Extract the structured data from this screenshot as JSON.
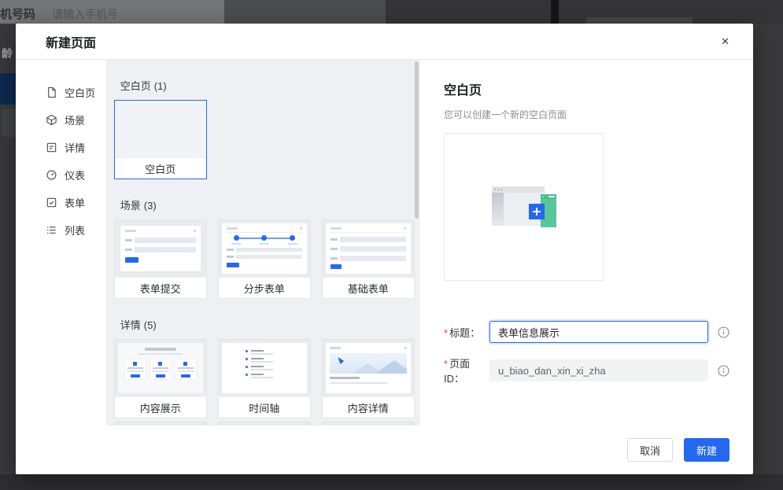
{
  "colors": {
    "primary": "#2468f2",
    "selected_card_border": "#2468f2",
    "required_mark": "#f04134",
    "gallery_bg": "#eef0f3",
    "overlay_bg": "#39393b",
    "illustration_green": "#57c69b",
    "illustration_blue": "#2667f2"
  },
  "backdrop": {
    "phone_label": "机号码",
    "phone_placeholder": "请输入手机号",
    "age_label": "龄"
  },
  "modal": {
    "title": "新建页面",
    "close_glyph": "✕"
  },
  "sidebar": {
    "items": [
      {
        "label": "空白页",
        "icon": "blank-page-icon"
      },
      {
        "label": "场景",
        "icon": "scene-cube-icon"
      },
      {
        "label": "详情",
        "icon": "detail-doc-icon"
      },
      {
        "label": "仪表",
        "icon": "dashboard-gauge-icon"
      },
      {
        "label": "表单",
        "icon": "form-check-icon"
      },
      {
        "label": "列表",
        "icon": "list-lines-icon"
      }
    ]
  },
  "templates": {
    "sections": [
      {
        "title": "空白页",
        "count": "(1)",
        "cards": [
          {
            "label": "空白页",
            "selected": true
          }
        ]
      },
      {
        "title": "场景",
        "count": "(3)",
        "cards": [
          {
            "label": "表单提交"
          },
          {
            "label": "分步表单"
          },
          {
            "label": "基础表单"
          }
        ]
      },
      {
        "title": "详情",
        "count": "(5)",
        "cards": [
          {
            "label": "内容展示"
          },
          {
            "label": "时间轴"
          },
          {
            "label": "内容详情"
          }
        ]
      }
    ]
  },
  "detail": {
    "title": "空白页",
    "description": "您可以创建一个新的空白页面",
    "fields": [
      {
        "star": "*",
        "label": "标题：",
        "value": "表单信息展示",
        "state": "focused"
      },
      {
        "star": "*",
        "label": "页面ID：",
        "value": "u_biao_dan_xin_xi_zha",
        "state": "readonly"
      }
    ]
  },
  "footer": {
    "cancel_label": "取消",
    "create_label": "新建"
  }
}
